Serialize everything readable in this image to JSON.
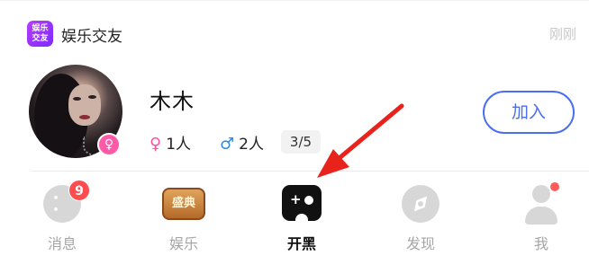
{
  "card": {
    "app_badge": {
      "line1": "娱乐",
      "line2": "交友"
    },
    "app_name": "娱乐交友",
    "time": "刚刚"
  },
  "room": {
    "name": "木木",
    "host_gender_symbol": "♀",
    "female_symbol": "♀",
    "female_count": "1人",
    "male_symbol": "♂",
    "male_count": "2人",
    "capacity": "3/5",
    "join_label": "加入"
  },
  "nav": {
    "items": [
      {
        "label": "消息",
        "icon": "message-icon",
        "badge": "9",
        "active": false
      },
      {
        "label": "娱乐",
        "icon": "entertainment-icon",
        "icon_text": "盛典",
        "active": false
      },
      {
        "label": "开黑",
        "icon": "gamepad-icon",
        "active": true
      },
      {
        "label": "发现",
        "icon": "compass-icon",
        "active": false
      },
      {
        "label": "我",
        "icon": "profile-icon",
        "has_dot": true,
        "active": false
      }
    ]
  },
  "colors": {
    "accent_blue": "#4a6ef0",
    "female_pink": "#ff4fa0",
    "male_blue": "#2b8be6",
    "badge_red": "#ff4d4f",
    "arrow_red": "#e8231b"
  }
}
